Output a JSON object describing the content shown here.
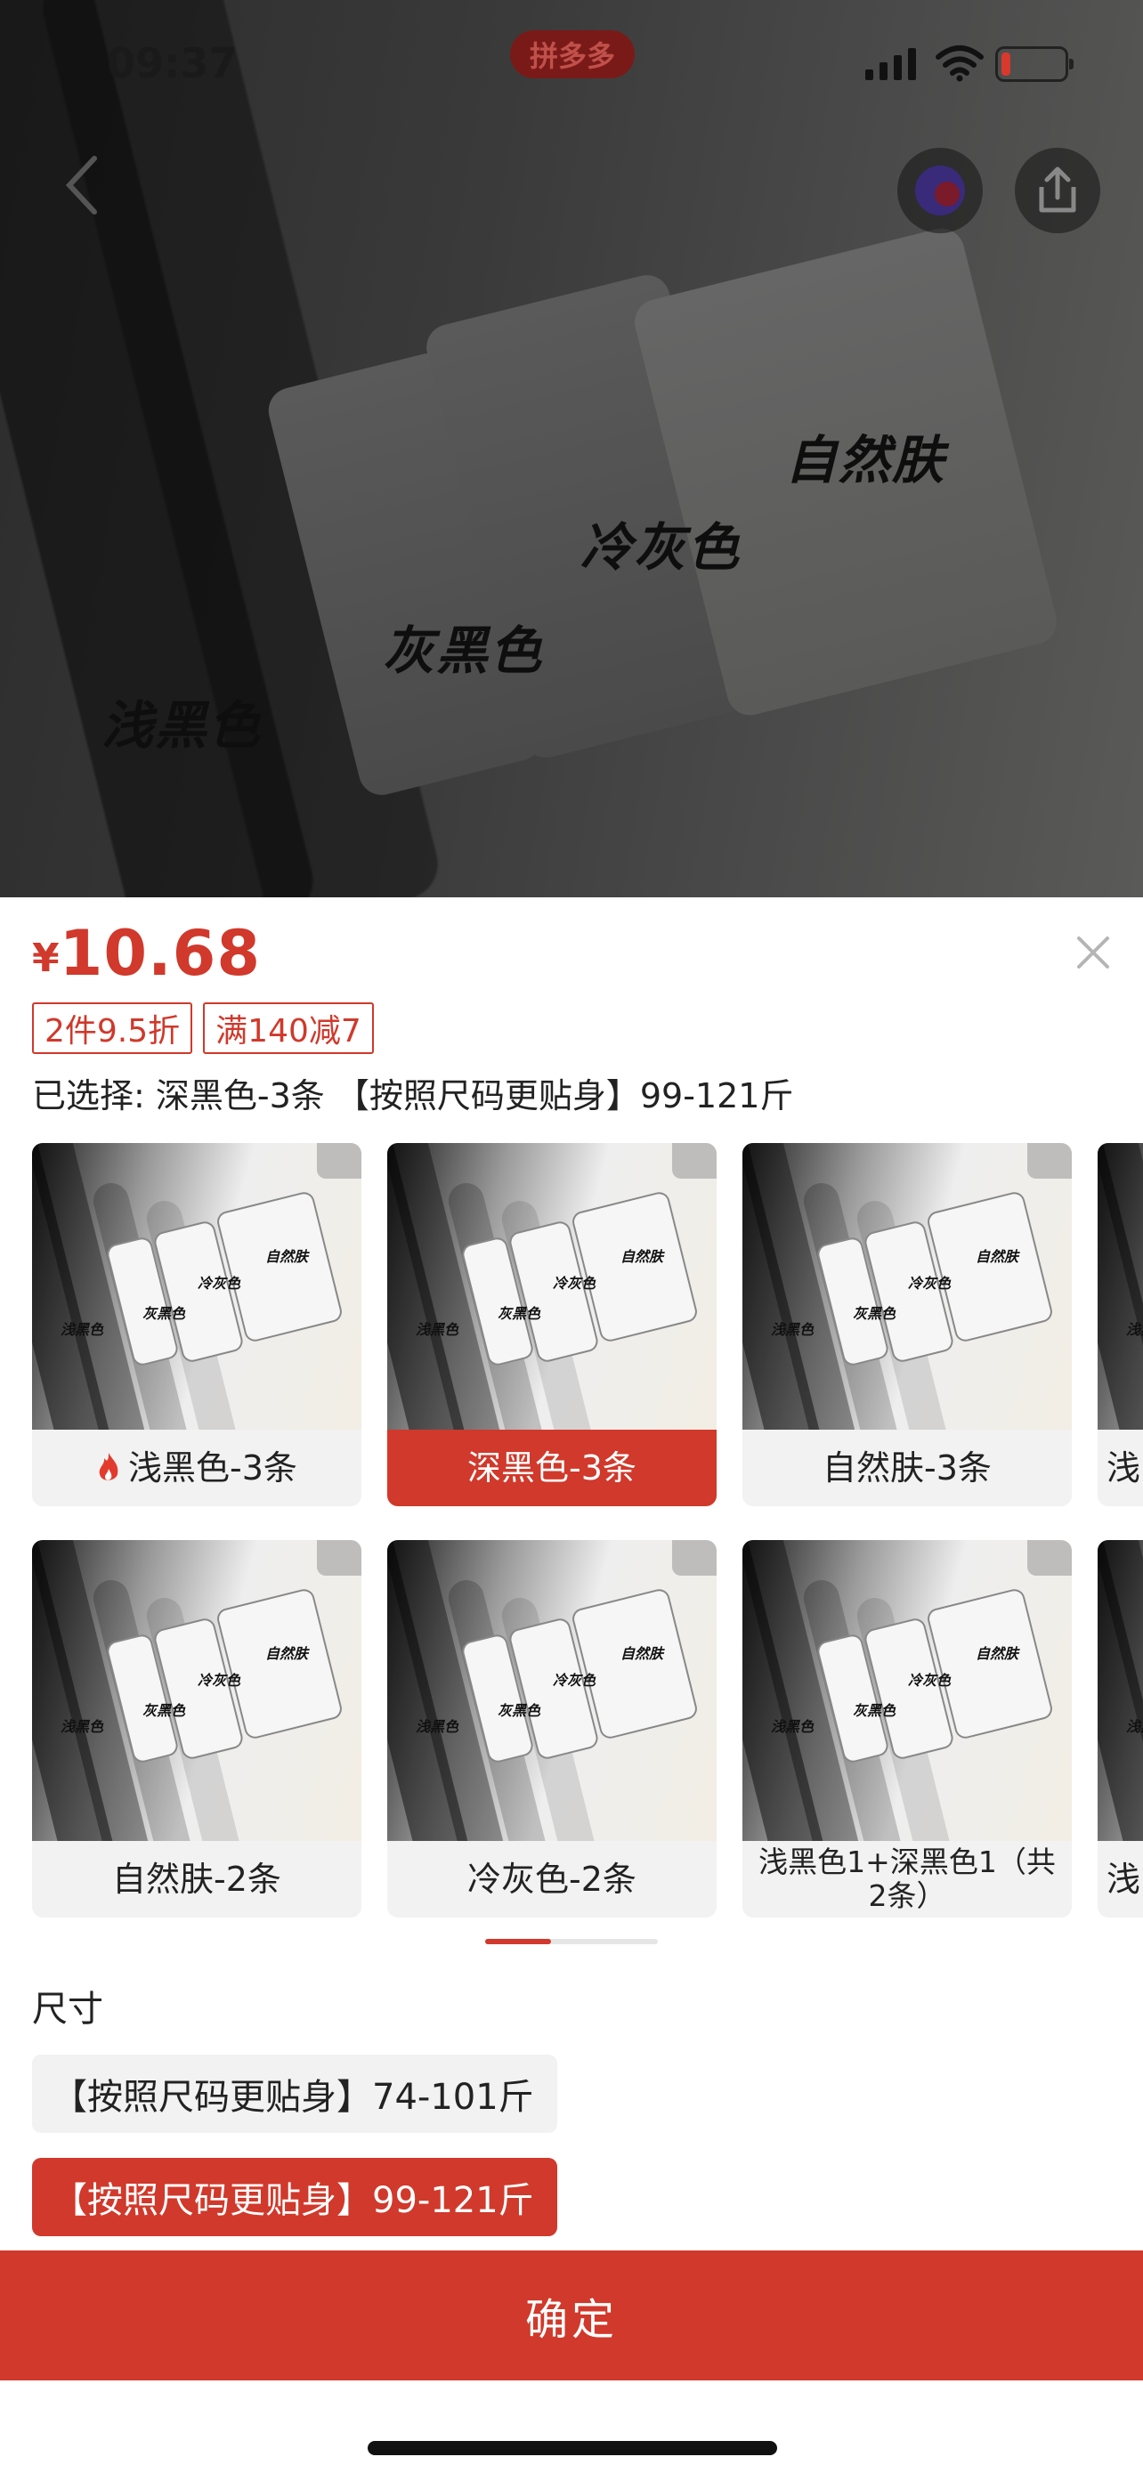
{
  "status_bar": {
    "time": "09:37",
    "app_tag": "拼多多"
  },
  "hero": {
    "labels": [
      "自然肤",
      "冷灰色",
      "灰黑色",
      "浅黑色"
    ]
  },
  "sheet": {
    "price_currency": "¥",
    "price": "10.68",
    "tags": [
      "2件9.5折",
      "满140减7"
    ],
    "selected_text": "已选择: 深黑色-3条 【按照尺码更贴身】99-121斤",
    "thumb_labels": [
      "自然肤",
      "冷灰色",
      "灰黑色",
      "浅黑色"
    ],
    "options": [
      {
        "label": "浅黑色-3条",
        "hot": true,
        "active": false
      },
      {
        "label": "深黑色-3条",
        "hot": false,
        "active": true
      },
      {
        "label": "自然肤-3条",
        "hot": false,
        "active": false
      },
      {
        "label": "浅",
        "hot": false,
        "active": false
      },
      {
        "label": "自然肤-2条",
        "hot": false,
        "active": false
      },
      {
        "label": "冷灰色-2条",
        "hot": false,
        "active": false
      },
      {
        "label": "浅黑色1+深黑色1（共2条）",
        "hot": false,
        "active": false
      },
      {
        "label": "浅",
        "hot": false,
        "active": false
      }
    ],
    "size_title": "尺寸",
    "sizes": [
      {
        "label": "【按照尺码更贴身】74-101斤",
        "active": false
      },
      {
        "label": "【按照尺码更贴身】99-121斤",
        "active": true
      }
    ],
    "confirm_label": "确定"
  },
  "colors": {
    "accent": "#d0392b"
  }
}
